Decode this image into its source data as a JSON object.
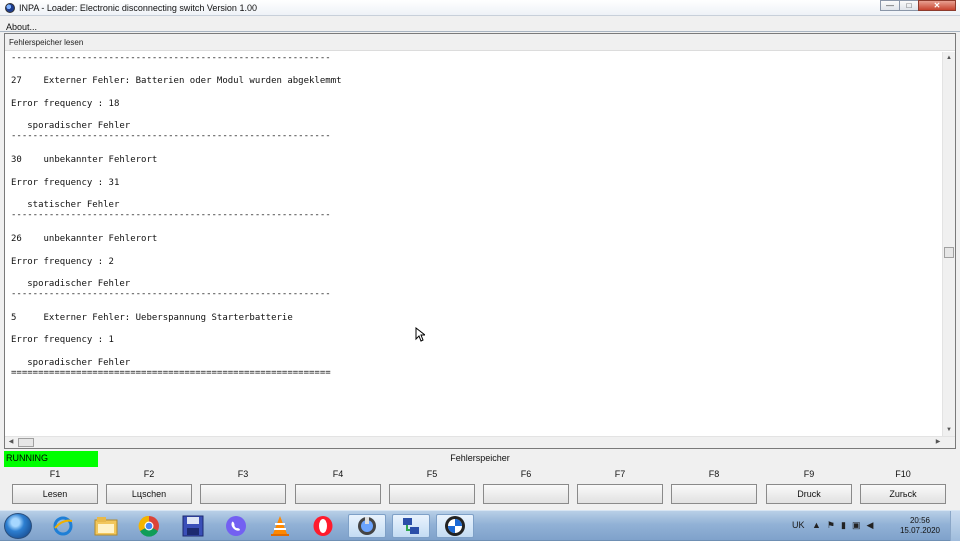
{
  "window": {
    "title": "INPA - Loader:  Electronic disconnecting switch Version 1.00",
    "controls": {
      "minimize": "—",
      "maximize": "□",
      "close": "✕"
    }
  },
  "menu": {
    "items": [
      {
        "label": "About..."
      }
    ]
  },
  "panel": {
    "header": "Fehlerspeicher lesen",
    "lines": [
      "-----------------------------------------------------------",
      "27    Externer Fehler: Batterien oder Modul wurden abgeklemmt",
      "Error frequency : 18",
      "   sporadischer Fehler",
      "-----------------------------------------------------------",
      "30    unbekannter Fehlerort",
      "Error frequency : 31",
      "   statischer Fehler",
      "-----------------------------------------------------------",
      "26    unbekannter Fehlerort",
      "Error frequency : 2",
      "   sporadischer Fehler",
      "-----------------------------------------------------------",
      "5     Externer Fehler: Ueberspannung Starterbatterie",
      "Error frequency : 1",
      "   sporadischer Fehler",
      "==========================================================="
    ]
  },
  "status": {
    "state": "RUNNING",
    "state_color": "#00ff00",
    "title": "Fehlerspeicher"
  },
  "fkeys": [
    {
      "key": "F1",
      "label": "Lesen"
    },
    {
      "key": "F2",
      "label": "Lцschen"
    },
    {
      "key": "F3",
      "label": ""
    },
    {
      "key": "F4",
      "label": ""
    },
    {
      "key": "F5",
      "label": ""
    },
    {
      "key": "F6",
      "label": ""
    },
    {
      "key": "F7",
      "label": ""
    },
    {
      "key": "F8",
      "label": ""
    },
    {
      "key": "F9",
      "label": "Druck"
    },
    {
      "key": "F10",
      "label": "Zurьck"
    }
  ],
  "taskbar": {
    "apps": [
      "internet-explorer-icon",
      "file-explorer-icon",
      "chrome-icon",
      "save-disk-icon",
      "viber-icon",
      "vlc-icon",
      "opera-icon",
      "inpa-icon",
      "network-app-icon",
      "bmw-icon"
    ],
    "language": "UK",
    "time": "20:56",
    "date": "15.07.2020"
  }
}
